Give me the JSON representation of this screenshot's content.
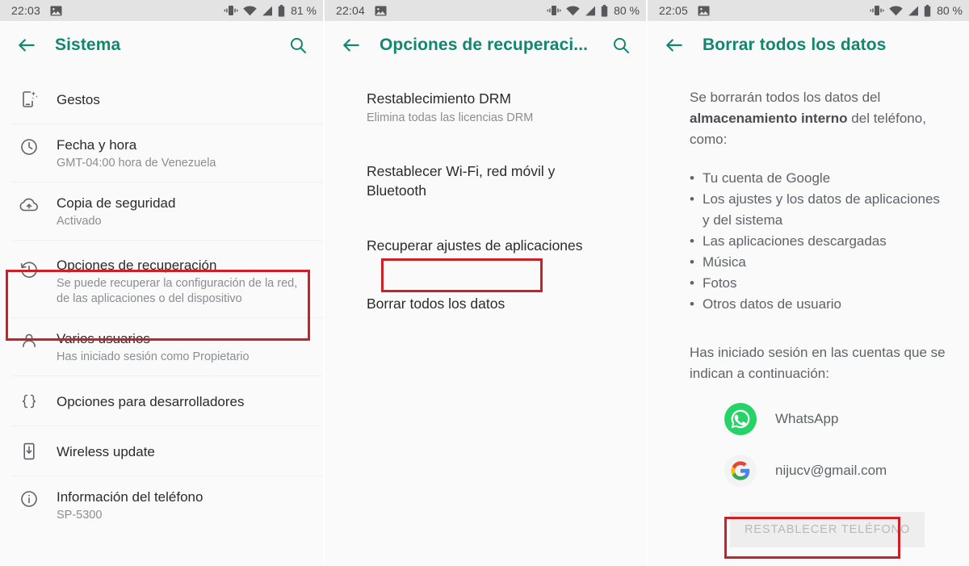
{
  "colors": {
    "accent_teal": "#12876f",
    "annotation_red": "#cc2028",
    "statusbar_bg": "#e3e3e3",
    "panel_bg": "#fafafa",
    "primary_text": "#2b2b2b",
    "secondary_text": "#8a8d91",
    "whatsapp_green": "#25d366"
  },
  "panels": [
    {
      "id": "system-settings",
      "statusbar": {
        "time": "22:03",
        "notification_icon": "image-notification-icon",
        "vibrate_icon": "vibrate-icon",
        "wifi_icon": "wifi-icon",
        "signal_icon": "cellular-signal-icon",
        "battery_icon": "battery-icon",
        "battery_percent": "81 %"
      },
      "appbar": {
        "back_icon": "arrow-back-icon",
        "title": "Sistema",
        "search_icon": "search-icon",
        "has_search": true
      },
      "items": [
        {
          "icon": "gestures-phone-sparkle-icon",
          "title": "Gestos",
          "subtitle": ""
        },
        {
          "icon": "clock-icon",
          "title": "Fecha y hora",
          "subtitle": "GMT-04:00 hora de Venezuela"
        },
        {
          "icon": "cloud-upload-icon",
          "title": "Copia de seguridad",
          "subtitle": "Activado"
        },
        {
          "icon": "history-restore-icon",
          "title": "Opciones de recuperación",
          "subtitle": "Se puede recuperar la configuración de la red, de las aplicaciones o del dispositivo",
          "highlighted": true
        },
        {
          "icon": "person-icon",
          "title": "Varios usuarios",
          "subtitle": "Has iniciado sesión como Propietario"
        },
        {
          "icon": "curly-braces-icon",
          "title": "Opciones para desarrolladores",
          "subtitle": ""
        },
        {
          "icon": "phone-download-icon",
          "title": "Wireless update",
          "subtitle": ""
        },
        {
          "icon": "info-circle-icon",
          "title": "Información del teléfono",
          "subtitle": "SP-5300"
        }
      ]
    },
    {
      "id": "recovery-options",
      "statusbar": {
        "time": "22:04",
        "notification_icon": "image-notification-icon",
        "vibrate_icon": "vibrate-icon",
        "wifi_icon": "wifi-icon",
        "signal_icon": "cellular-signal-icon",
        "battery_icon": "battery-icon",
        "battery_percent": "80 %"
      },
      "appbar": {
        "back_icon": "arrow-back-icon",
        "title": "Opciones de recuperaci...",
        "search_icon": "search-icon",
        "has_search": true
      },
      "items": [
        {
          "title": "Restablecimiento DRM",
          "subtitle": "Elimina todas las licencias DRM"
        },
        {
          "title": "Restablecer Wi-Fi, red móvil y Bluetooth",
          "subtitle": ""
        },
        {
          "title": "Recuperar ajustes de aplicaciones",
          "subtitle": ""
        },
        {
          "title": "Borrar todos los datos",
          "subtitle": "",
          "highlighted": true
        }
      ]
    },
    {
      "id": "factory-reset",
      "statusbar": {
        "time": "22:05",
        "notification_icon": "image-notification-icon",
        "vibrate_icon": "vibrate-icon",
        "wifi_icon": "wifi-icon",
        "signal_icon": "cellular-signal-icon",
        "battery_icon": "battery-icon",
        "battery_percent": "80 %"
      },
      "appbar": {
        "back_icon": "arrow-back-icon",
        "title": "Borrar todos los datos",
        "has_search": false
      },
      "intro_before": "Se borrarán todos los datos del ",
      "intro_bold": "almacenamiento interno",
      "intro_after": " del teléfono, como:",
      "bullets": [
        "Tu cuenta de Google",
        "Los ajustes y los datos de aplicaciones y del sistema",
        "Las aplicaciones descargadas",
        "Música",
        "Fotos",
        "Otros datos de usuario"
      ],
      "accounts_intro": "Has iniciado sesión en las cuentas que se indican a continuación:",
      "accounts": [
        {
          "icon": "whatsapp-icon",
          "name": "WhatsApp"
        },
        {
          "icon": "google-icon",
          "name": "nijucv@gmail.com"
        }
      ],
      "reset_button_label": "RESTABLECER TELÉFONO"
    }
  ]
}
